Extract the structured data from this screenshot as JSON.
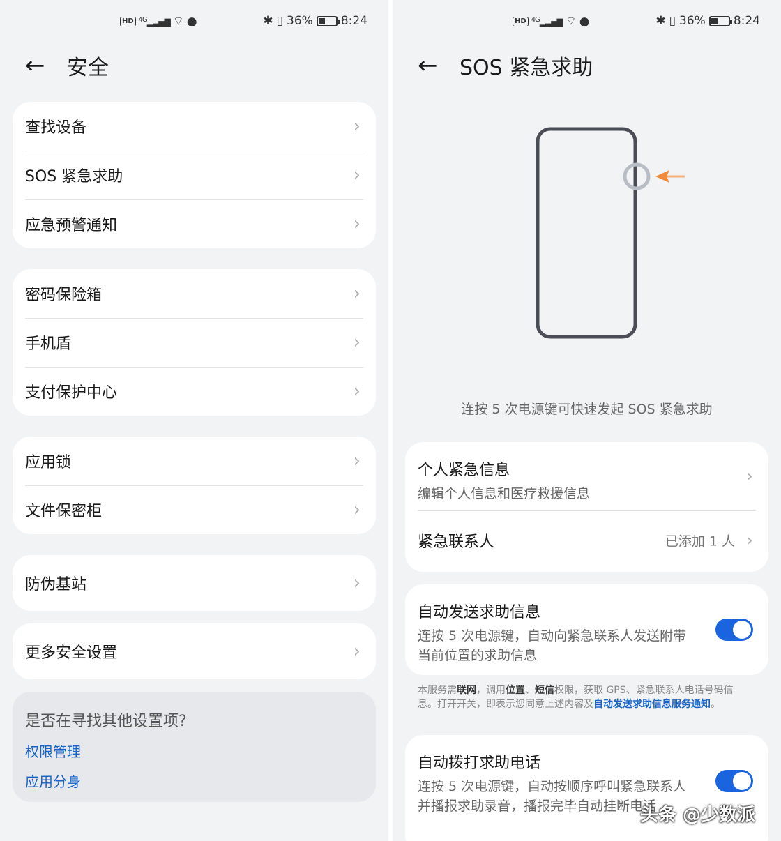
{
  "left": {
    "status": {
      "network": "4G",
      "wifi_badge": "6",
      "battery": "36%",
      "battery_level": 0.36,
      "time": "8:24"
    },
    "header": {
      "back_icon": "arrow-left",
      "title": "安全"
    },
    "groups": [
      [
        "查找设备",
        "SOS 紧急求助",
        "应急预警通知"
      ],
      [
        "密码保险箱",
        "手机盾",
        "支付保护中心"
      ],
      [
        "应用锁",
        "文件保密柜"
      ],
      [
        "防伪基站"
      ],
      [
        "更多安全设置"
      ]
    ],
    "suggest": {
      "question": "是否在寻找其他设置项?",
      "links": [
        "权限管理",
        "应用分身"
      ]
    }
  },
  "right": {
    "status": {
      "network": "4G",
      "wifi_badge": "6",
      "battery": "36%",
      "battery_level": 0.36,
      "time": "8:24"
    },
    "header": {
      "back_icon": "arrow-left",
      "title": "SOS 紧急求助"
    },
    "caption": "连按 5 次电源键可快速发起 SOS 紧急求助",
    "personal": {
      "title": "个人紧急信息",
      "subtitle": "编辑个人信息和医疗救援信息"
    },
    "contacts": {
      "title": "紧急联系人",
      "value": "已添加 1 人"
    },
    "auto_msg": {
      "title": "自动发送求助信息",
      "subtitle": "连按 5 次电源键，自动向紧急联系人发送附带当前位置的求助信息",
      "enabled": true
    },
    "notice": {
      "p1": "本服务需",
      "b1": "联网",
      "p2": "，调用",
      "b2": "位置",
      "p3": "、",
      "b3": "短信",
      "p4": "权限，获取 GPS、紧急联系人电话号码信息。打开开关，即表示您同意上述内容及",
      "link": "自动发送求助信息服务通知",
      "p5": "。"
    },
    "auto_call": {
      "title": "自动拨打求助电话",
      "subtitle": "连按 5 次电源键，自动按顺序呼叫紧急联系人并播报求助录音，播报完毕自动挂断电话",
      "enabled": true
    },
    "watermark": "头条 @少数派",
    "colors": {
      "accent": "#1a64e0",
      "arrow": "#f08a3a"
    }
  }
}
